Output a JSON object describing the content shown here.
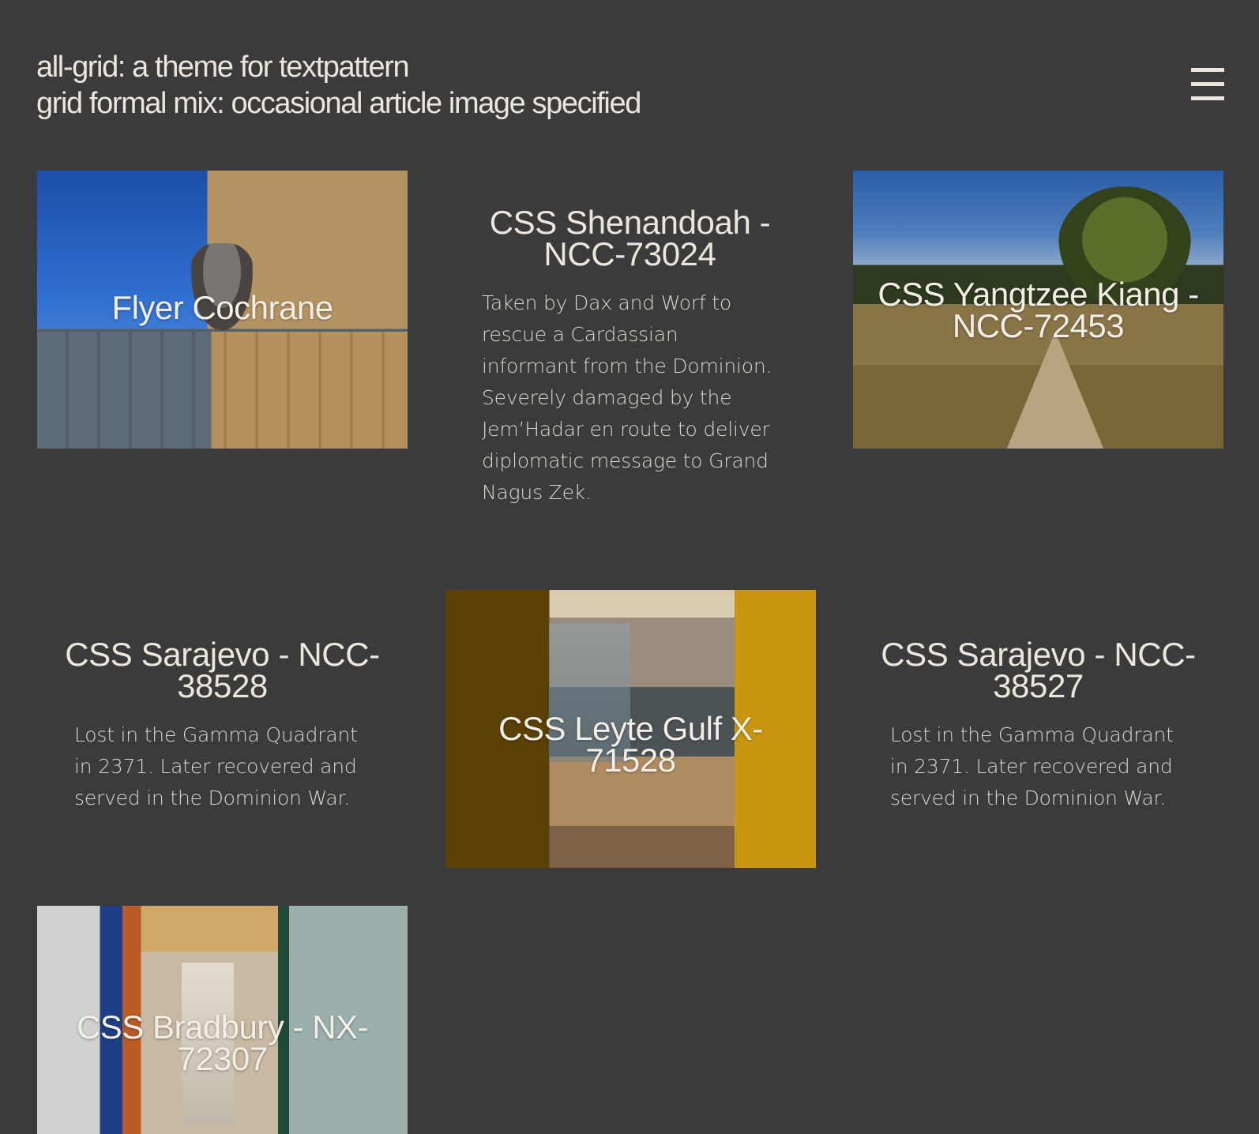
{
  "header": {
    "site_title": "all-grid: a theme for textpattern",
    "site_subtitle": "grid formal mix: occasional article image specified"
  },
  "menu": {
    "icon": "hamburger-menu-icon"
  },
  "articles": [
    {
      "title": "Flyer Cochrane",
      "type": "image",
      "image": "cat-on-fence-photo"
    },
    {
      "title": "CSS Shenandoah - NCC-73024",
      "type": "text",
      "body": "Taken by Dax and Worf to rescue a Cardassian informant from the Dominion. Severely damaged by the Jem’Hadar en route to deliver diplomatic message to Grand Nagus Zek."
    },
    {
      "title": "CSS Yangtzee Kiang - NCC-72453",
      "type": "image",
      "image": "boardwalk-solar-panels-photo"
    },
    {
      "title": "CSS Sarajevo - NCC-38528",
      "type": "text",
      "body": "Lost in the Gamma Quadrant in 2371. Later recovered and served in the Dominion War."
    },
    {
      "title": "CSS Leyte Gulf X-71528",
      "type": "image",
      "image": "bathroom-mirror-photo"
    },
    {
      "title": "CSS Sarajevo - NCC-38527",
      "type": "text",
      "body": "Lost in the Gamma Quadrant in 2371. Later recovered and served in the Dominion War."
    },
    {
      "title": "CSS Bradbury - NX-72307",
      "type": "image",
      "image": "hallway-mural-photo"
    }
  ]
}
